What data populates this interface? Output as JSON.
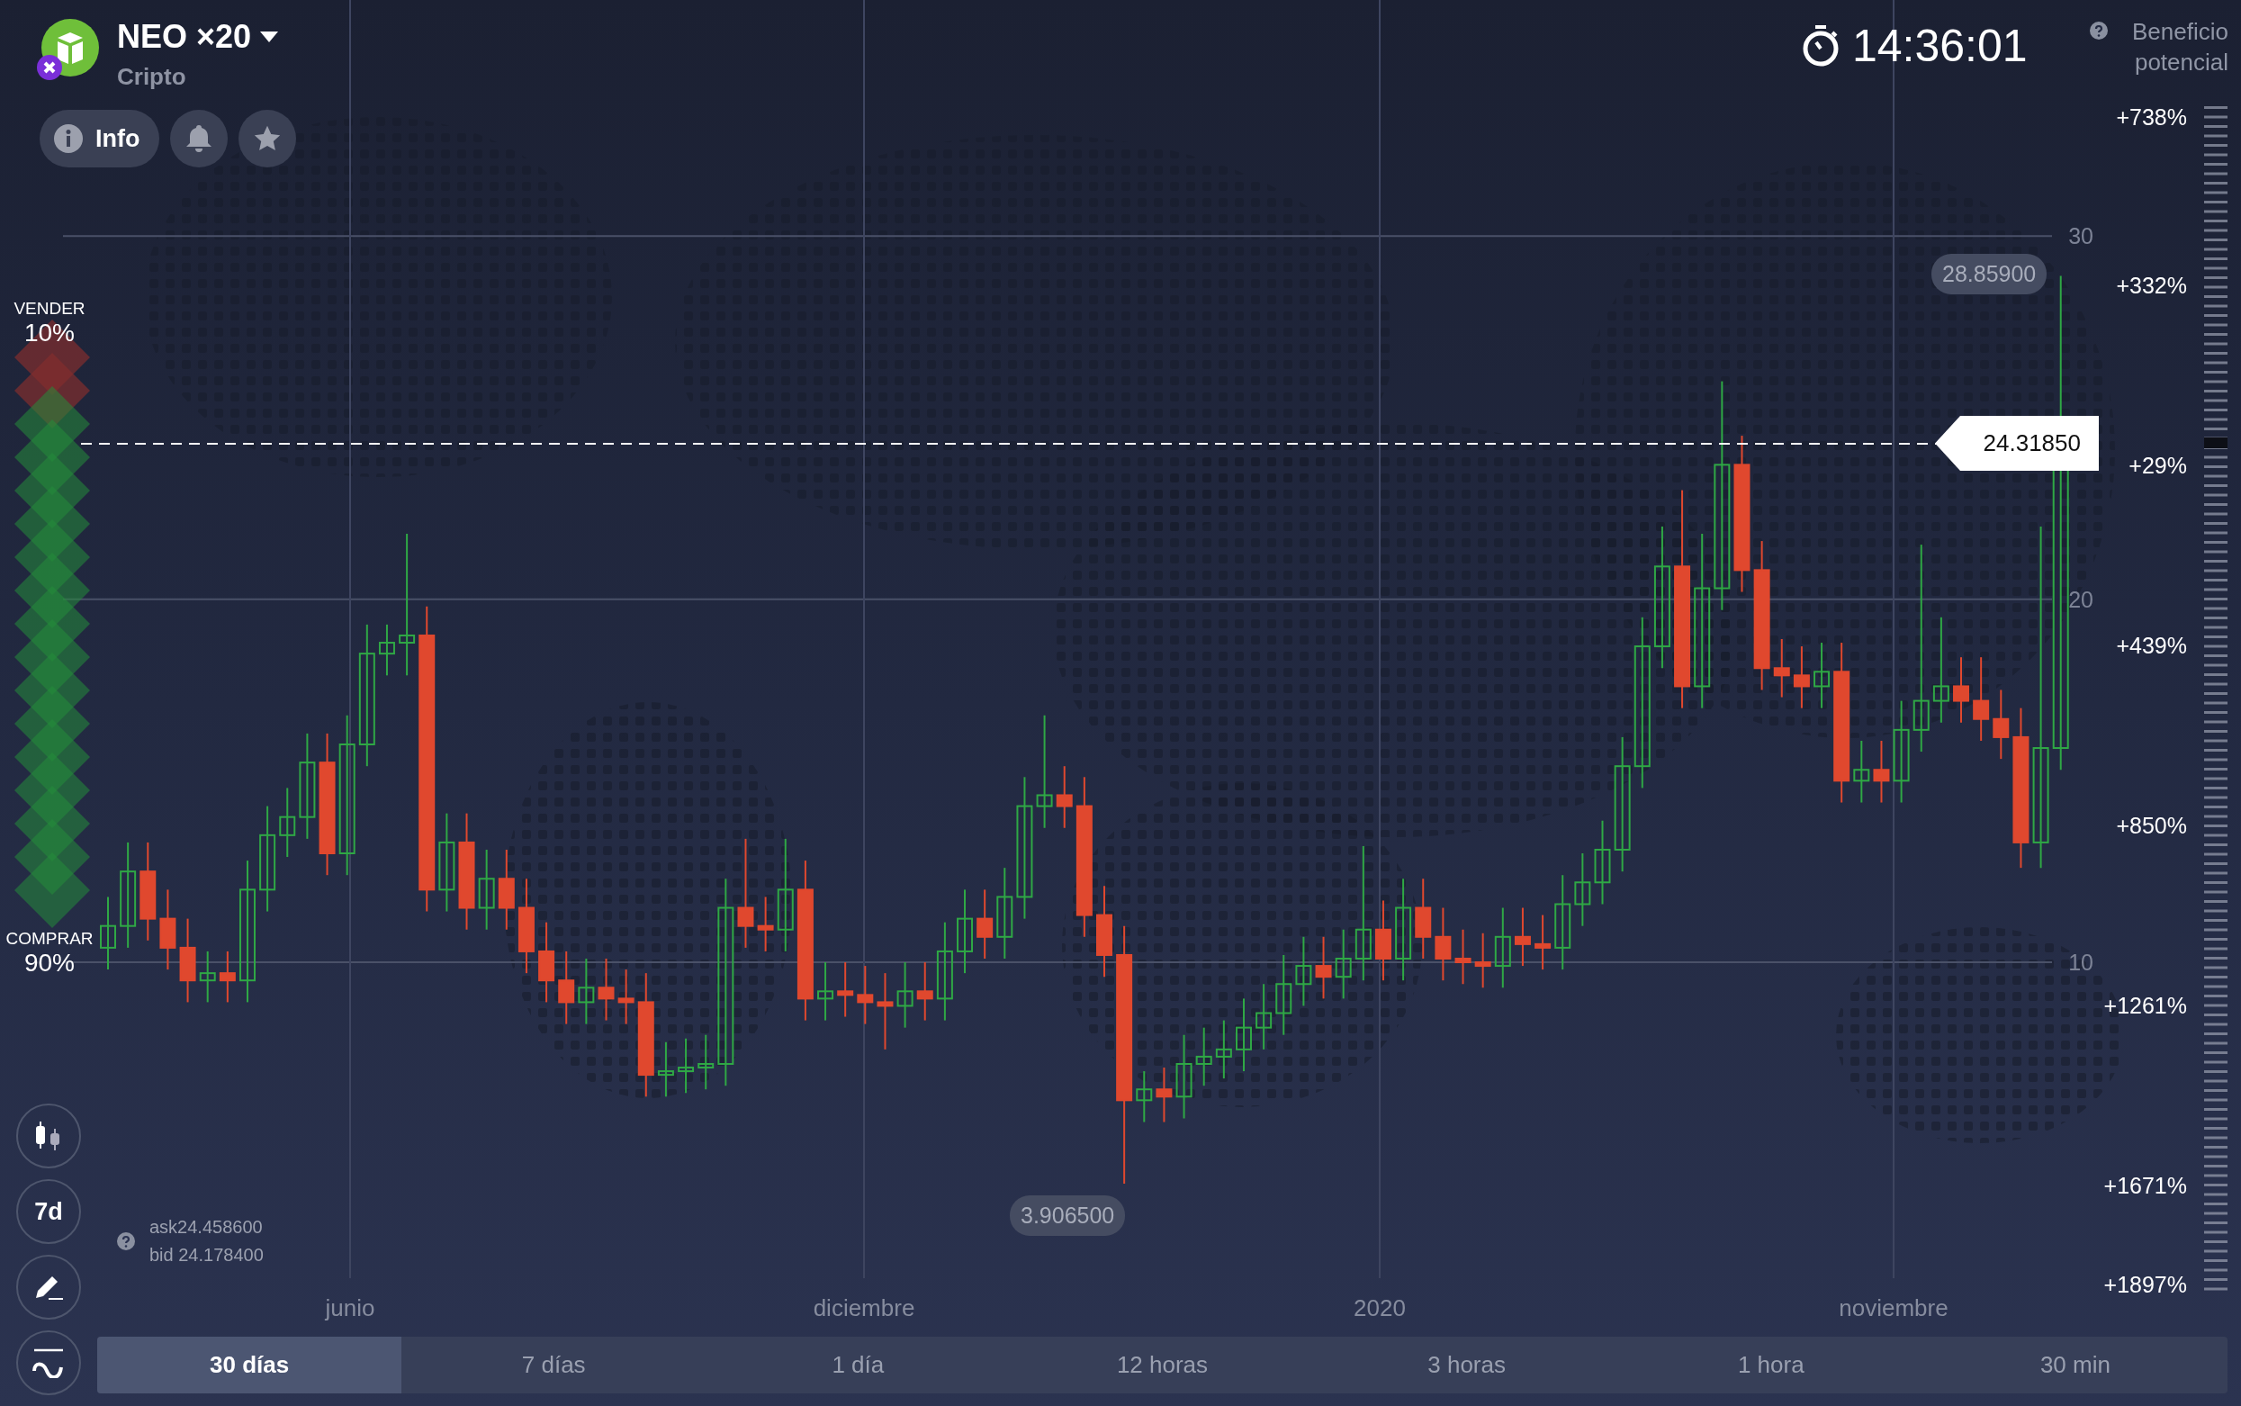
{
  "asset": {
    "name": "NEO ×20",
    "category": "Cripto"
  },
  "header_buttons": [
    {
      "kind": "info",
      "label": "Info"
    },
    {
      "kind": "bell"
    },
    {
      "kind": "star"
    }
  ],
  "timer": "14:36:01",
  "profit_label": "Beneficio potencial",
  "profit_scale": [
    "+738%",
    "+332%",
    "+29%",
    "+439%",
    "+850%",
    "+1261%",
    "+1671%",
    "+1897%"
  ],
  "chart": {
    "high_label": "28.85900",
    "low_label": "3.906500",
    "current_price": "24.31850",
    "chart_data": {
      "type": "candlestick",
      "grid": true,
      "ylim": [
        1.3,
        36.5
      ],
      "ohlc": [
        [
          10.4,
          11.8,
          9.8,
          11
        ],
        [
          11,
          13.3,
          10.4,
          12.5
        ],
        [
          12.5,
          13.3,
          10.6,
          11.2
        ],
        [
          11.2,
          12,
          9.8,
          10.4
        ],
        [
          10.4,
          11.2,
          8.9,
          9.5
        ],
        [
          9.5,
          10.3,
          8.9,
          9.7
        ],
        [
          9.7,
          10.3,
          8.9,
          9.5
        ],
        [
          9.5,
          12.8,
          8.9,
          12
        ],
        [
          12,
          14.3,
          11.4,
          13.5
        ],
        [
          13.5,
          14.8,
          12.9,
          14
        ],
        [
          14,
          16.3,
          13.4,
          15.5
        ],
        [
          15.5,
          16.3,
          12.4,
          13
        ],
        [
          13,
          16.8,
          12.4,
          16
        ],
        [
          16,
          19.3,
          15.4,
          18.5
        ],
        [
          18.5,
          19.3,
          17.9,
          18.8
        ],
        [
          18.8,
          21.8,
          17.9,
          19
        ],
        [
          19,
          19.8,
          11.4,
          12
        ],
        [
          12,
          14.1,
          11.4,
          13.3
        ],
        [
          13.3,
          14.1,
          10.9,
          11.5
        ],
        [
          11.5,
          13.1,
          10.9,
          12.3
        ],
        [
          12.3,
          13.1,
          10.9,
          11.5
        ],
        [
          11.5,
          12.3,
          9.7,
          10.3
        ],
        [
          10.3,
          11.1,
          8.9,
          9.5
        ],
        [
          9.5,
          10.3,
          8.3,
          8.9
        ],
        [
          8.9,
          10.1,
          8.3,
          9.3
        ],
        [
          9.3,
          10.1,
          8.4,
          9
        ],
        [
          9,
          9.8,
          8.3,
          8.9
        ],
        [
          8.9,
          9.7,
          6.3,
          6.9
        ],
        [
          6.9,
          7.8,
          6.3,
          7
        ],
        [
          7,
          7.9,
          6.4,
          7.1
        ],
        [
          7.1,
          8,
          6.5,
          7.2
        ],
        [
          7.2,
          12.3,
          6.6,
          11.5
        ],
        [
          11.5,
          13.4,
          10.4,
          11
        ],
        [
          11,
          11.8,
          10.3,
          10.9
        ],
        [
          10.9,
          13.4,
          10.3,
          12
        ],
        [
          12,
          12.8,
          8.4,
          9
        ],
        [
          9,
          10,
          8.4,
          9.2
        ],
        [
          9.2,
          10,
          8.5,
          9.1
        ],
        [
          9.1,
          9.9,
          8.3,
          8.9
        ],
        [
          8.9,
          9.7,
          7.6,
          8.8
        ],
        [
          8.8,
          10,
          8.2,
          9.2
        ],
        [
          9.2,
          10,
          8.4,
          9
        ],
        [
          9,
          11.1,
          8.4,
          10.3
        ],
        [
          10.3,
          12,
          9.7,
          11.2
        ],
        [
          11.2,
          12,
          10.1,
          10.7
        ],
        [
          10.7,
          12.6,
          10.1,
          11.8
        ],
        [
          11.8,
          15.1,
          11.2,
          14.3
        ],
        [
          14.3,
          16.8,
          13.7,
          14.6
        ],
        [
          14.6,
          15.4,
          13.7,
          14.3
        ],
        [
          14.3,
          15.1,
          10.7,
          11.3
        ],
        [
          11.3,
          12.1,
          9.6,
          10.2
        ],
        [
          10.2,
          11,
          3.9,
          6.2
        ],
        [
          6.2,
          7,
          5.6,
          6.5
        ],
        [
          6.5,
          7.1,
          5.6,
          6.3
        ],
        [
          6.3,
          8,
          5.7,
          7.2
        ],
        [
          7.2,
          8.2,
          6.6,
          7.4
        ],
        [
          7.4,
          8.4,
          6.8,
          7.6
        ],
        [
          7.6,
          9,
          7,
          8.2
        ],
        [
          8.2,
          9.4,
          7.6,
          8.6
        ],
        [
          8.6,
          10.2,
          8,
          9.4
        ],
        [
          9.4,
          10.7,
          8.8,
          9.9
        ],
        [
          9.9,
          10.7,
          9,
          9.6
        ],
        [
          9.6,
          10.9,
          9,
          10.1
        ],
        [
          10.1,
          13.2,
          9.5,
          10.9
        ],
        [
          10.9,
          11.7,
          9.5,
          10.1
        ],
        [
          10.1,
          12.3,
          9.5,
          11.5
        ],
        [
          11.5,
          12.3,
          10.1,
          10.7
        ],
        [
          10.7,
          11.5,
          9.5,
          10.1
        ],
        [
          10.1,
          10.9,
          9.4,
          10
        ],
        [
          10,
          10.8,
          9.3,
          9.9
        ],
        [
          9.9,
          11.5,
          9.3,
          10.7
        ],
        [
          10.7,
          11.5,
          9.9,
          10.5
        ],
        [
          10.5,
          11.3,
          9.8,
          10.4
        ],
        [
          10.4,
          12.4,
          9.8,
          11.6
        ],
        [
          11.6,
          13,
          11,
          12.2
        ],
        [
          12.2,
          13.9,
          11.6,
          13.1
        ],
        [
          13.1,
          16.2,
          12.5,
          15.4
        ],
        [
          15.4,
          19.5,
          14.8,
          18.7
        ],
        [
          18.7,
          22,
          18.1,
          20.9
        ],
        [
          20.9,
          23,
          17,
          17.6
        ],
        [
          17.6,
          21.8,
          17,
          20.3
        ],
        [
          20.3,
          26,
          19.7,
          23.7
        ],
        [
          23.7,
          24.5,
          20.2,
          20.8
        ],
        [
          20.8,
          21.6,
          17.5,
          18.1
        ],
        [
          18.1,
          18.9,
          17.3,
          17.9
        ],
        [
          17.9,
          18.7,
          17,
          17.6
        ],
        [
          17.6,
          18.8,
          17,
          18
        ],
        [
          18,
          18.8,
          14.4,
          15
        ],
        [
          15,
          16.1,
          14.4,
          15.3
        ],
        [
          15.3,
          16.1,
          14.4,
          15
        ],
        [
          15,
          17.2,
          14.4,
          16.4
        ],
        [
          16.4,
          21.5,
          15.8,
          17.2
        ],
        [
          17.2,
          19.5,
          16.6,
          17.6
        ],
        [
          17.6,
          18.4,
          16.6,
          17.2
        ],
        [
          17.2,
          18.4,
          16.1,
          16.7
        ],
        [
          16.7,
          17.5,
          15.6,
          16.2
        ],
        [
          16.2,
          17,
          12.6,
          13.3
        ],
        [
          13.3,
          22,
          12.6,
          15.9
        ],
        [
          15.9,
          28.9,
          15.3,
          24.3
        ]
      ],
      "yticks": [
        {
          "value": 30,
          "label": "30"
        },
        {
          "value": 20,
          "label": "20"
        },
        {
          "value": 10,
          "label": "10"
        }
      ]
    },
    "x_labels": [
      "junio",
      "diciembre",
      "2020",
      "noviembre"
    ]
  },
  "mood": {
    "sell_label": "VENDER",
    "sell_percent": "10%",
    "buy_label": "COMPRAR",
    "buy_percent": "90%",
    "level": 0.9
  },
  "quote": {
    "ask": "ask24.458600",
    "bid": "bid 24.178400"
  },
  "tools": [
    {
      "kind": "candles"
    },
    {
      "kind": "period",
      "label": "7d"
    },
    {
      "kind": "draw"
    },
    {
      "kind": "indicators"
    }
  ],
  "periods": [
    {
      "label": "30 días",
      "selected": true
    },
    {
      "label": "7 días",
      "selected": false
    },
    {
      "label": "1 día",
      "selected": false
    },
    {
      "label": "12 horas",
      "selected": false
    },
    {
      "label": "3 horas",
      "selected": false
    },
    {
      "label": "1 hora",
      "selected": false
    },
    {
      "label": "30 min",
      "selected": false
    }
  ]
}
